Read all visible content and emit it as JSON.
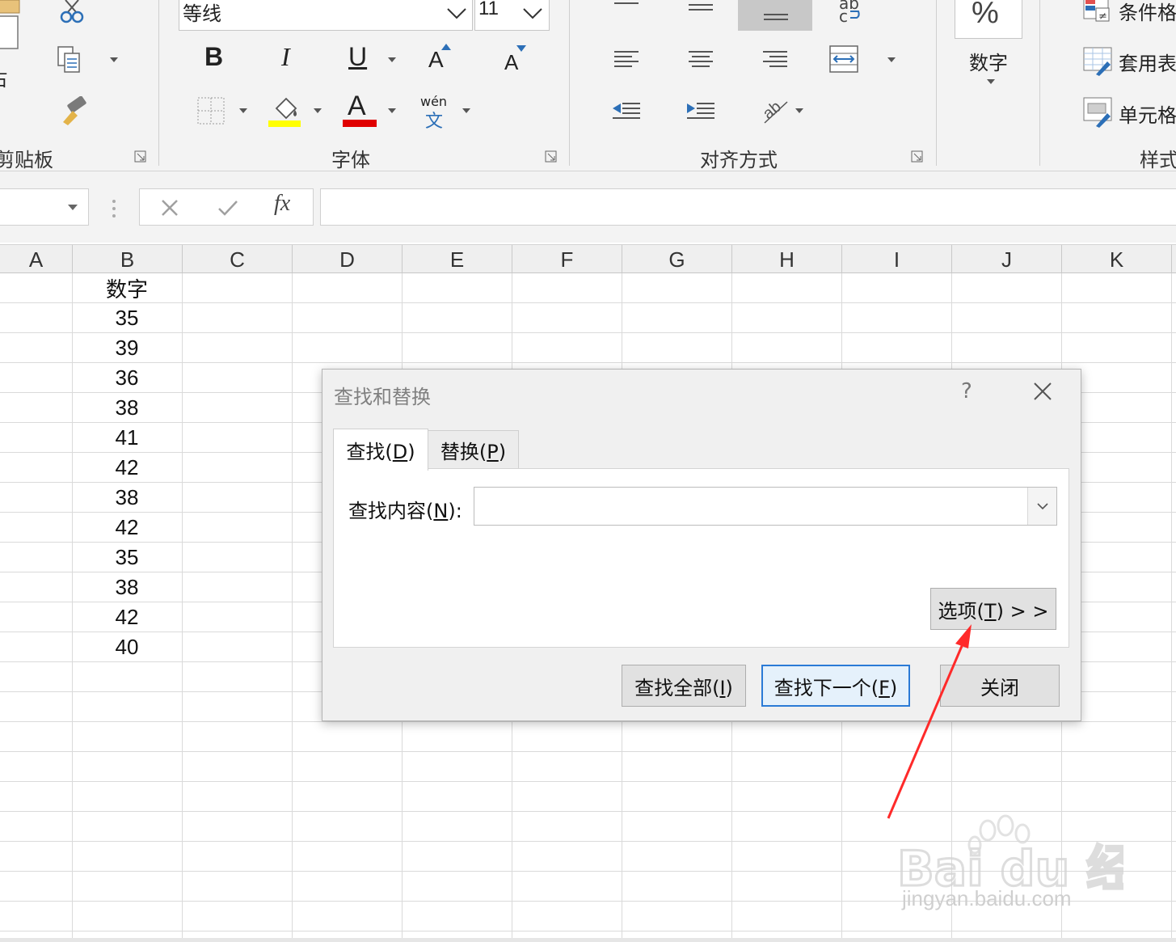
{
  "ribbon": {
    "clipboard": {
      "label": "剪贴板",
      "paste_partial": "占"
    },
    "font": {
      "label": "字体",
      "font_name": "等线",
      "font_size": "11",
      "bold": "B",
      "italic": "I",
      "underline": "U",
      "grow": "A",
      "shrink": "A",
      "font_color": "A",
      "phonetic_top": "wén",
      "phonetic_bottom": "文"
    },
    "alignment": {
      "label": "对齐方式",
      "wrap_top": "ab",
      "wrap_bottom": "c"
    },
    "number": {
      "label": "数字",
      "percent": "%"
    },
    "styles": {
      "label": "样式",
      "conditional": "条件格",
      "table": "套用表",
      "cell": "单元格"
    }
  },
  "formula_bar": {
    "fx": "fx"
  },
  "columns": [
    "A",
    "B",
    "C",
    "D",
    "E",
    "F",
    "G",
    "H",
    "I",
    "J",
    "K"
  ],
  "cells_b": [
    "数字",
    "35",
    "39",
    "36",
    "38",
    "41",
    "42",
    "38",
    "42",
    "35",
    "38",
    "42",
    "40"
  ],
  "dialog": {
    "title": "查找和替换",
    "help": "?",
    "tab_find_pre": "查找(",
    "tab_find_key": "D",
    "tab_find_post": ")",
    "tab_replace_pre": "替换(",
    "tab_replace_key": "P",
    "tab_replace_post": ")",
    "find_label_pre": "查找内容(",
    "find_label_key": "N",
    "find_label_post": "):",
    "find_value": "",
    "options_pre": "选项(",
    "options_key": "T",
    "options_post": ") > >",
    "findall_pre": "查找全部(",
    "findall_key": "I",
    "findall_post": ")",
    "findnext_pre": "查找下一个(",
    "findnext_key": "F",
    "findnext_post": ")",
    "close": "关闭"
  },
  "watermark": {
    "logo": "Bai du 经验",
    "url": "jingyan.baidu.com"
  },
  "colors": {
    "accent": "#2a7ad6",
    "arrow": "#ff2a2a",
    "fill_yellow": "#ffff00",
    "font_red": "#e00000"
  }
}
